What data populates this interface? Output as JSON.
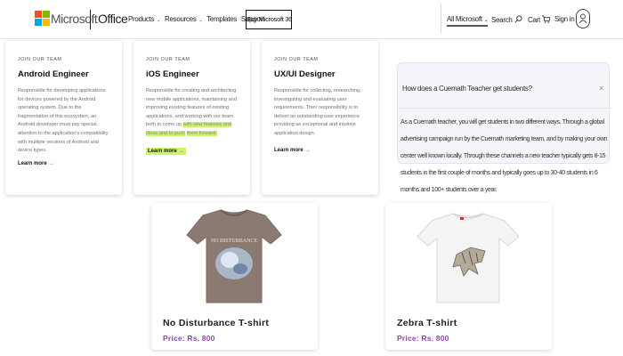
{
  "header": {
    "brand": "Microsoft",
    "product": "Office",
    "nav": [
      "Products",
      "Resources",
      "Templates",
      "Support"
    ],
    "buy_button": "Buy Microsoft 365",
    "all_microsoft": "All Microsoft",
    "search": "Search",
    "cart": "Cart",
    "sign_in": "Sign in",
    "logo_colors": [
      "#f25022",
      "#7fba00",
      "#00a4ef",
      "#ffb900"
    ]
  },
  "roles": [
    {
      "kicker": "JOIN OUR TEAM",
      "title": "Android Engineer",
      "description": "Responsible for developing applications for devices powered by the Android operating system. Due to the fragmentation of this ecosystem, an Android developer must pay special attention to the application's compatibility with multiple versions of Android and device types.",
      "learn_more": "Learn more"
    },
    {
      "kicker": "JOIN OUR TEAM",
      "title": "iOS Engineer",
      "description": "Responsible for creating and architecting new mobile applications, maintaining and improving existing features of existing applications, and working with our team both to come up",
      "highlight": "with new features and ideas and to push",
      "description_end": "them forward.",
      "learn_more": "Learn more"
    },
    {
      "kicker": "JOIN OUR TEAM",
      "title": "UX/UI Designer",
      "description": "Responsible for collecting, researching, investigating and evaluating user requirements. Their responsibility is to deliver an outstanding user experience providing an exceptional and intuitive application design.",
      "learn_more": "Learn more"
    }
  ],
  "faq": {
    "question": "How does a Cuemath Teacher get students?",
    "answer": "As a Cuemath teacher, you will get students in two different ways. Through a global advertising campaign run by the Cuemath marketing team, and by making your own center well known locally. Through these channels a new teacher typically gets 8-15 students in the first couple of months and typically goes up to 30-40 students in 6 months and 100+ students over a year."
  },
  "products": [
    {
      "name": "No Disturbance T-shirt",
      "price": "Price: Rs. 800",
      "color": "#8a7a72"
    },
    {
      "name": "Zebra T-shirt",
      "price": "Price: Rs. 800",
      "color": "#f2f2f2"
    }
  ],
  "colors": {
    "accent_orange": "#d24726",
    "highlight": "#ccf46a",
    "price_purple": "#8b47a6"
  }
}
